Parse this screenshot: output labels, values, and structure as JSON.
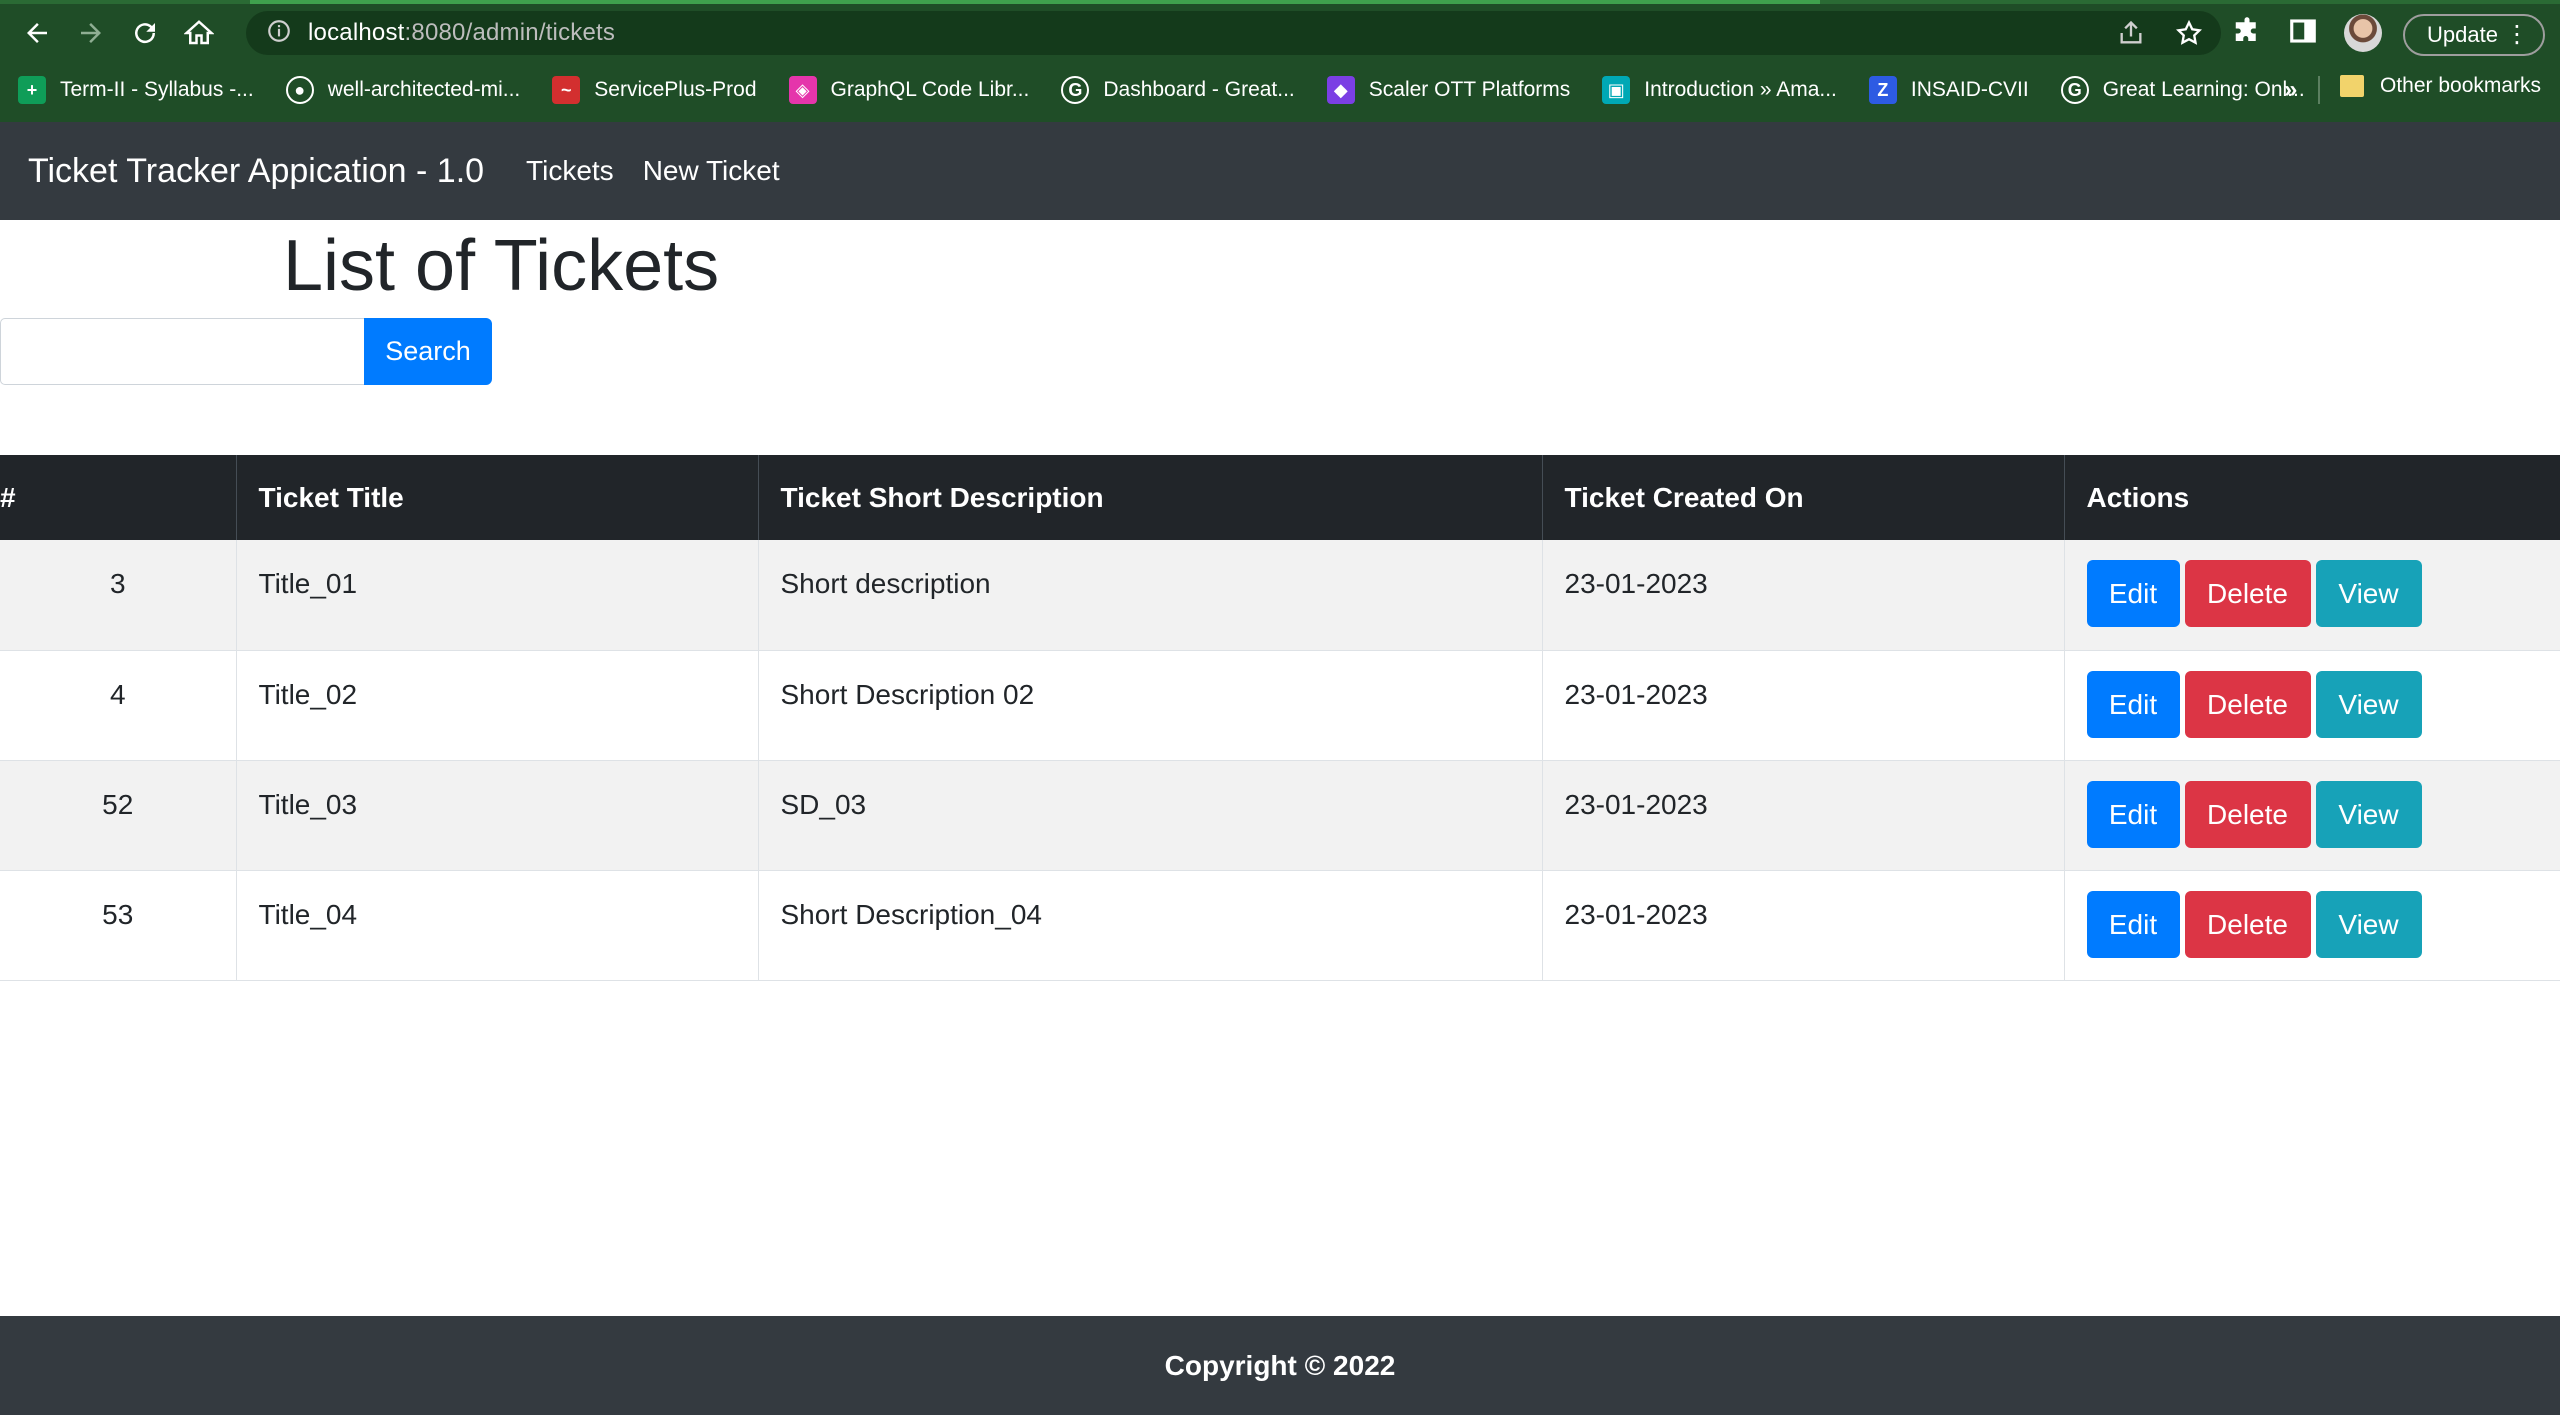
{
  "browser": {
    "url_host": "localhost",
    "url_rest": ":8080/admin/tickets",
    "update_label": "Update",
    "bookmarks": [
      {
        "label": "Term-II - Syllabus -...",
        "icon": "plus-icon",
        "color": "#0f9d58"
      },
      {
        "label": "well-architected-mi...",
        "icon": "github-icon",
        "color": "#ffffff"
      },
      {
        "label": "ServicePlus-Prod",
        "icon": "swoosh-icon",
        "color": "#d32f2f"
      },
      {
        "label": "GraphQL Code Libr...",
        "icon": "graphql-icon",
        "color": "#e535ab"
      },
      {
        "label": "Dashboard - Great...",
        "icon": "g-icon",
        "color": "#ffffff"
      },
      {
        "label": "Scaler OTT Platforms",
        "icon": "scaler-icon",
        "color": "#7b3fe4"
      },
      {
        "label": "Introduction » Ama...",
        "icon": "amazon-icon",
        "color": "#00a8b5"
      },
      {
        "label": "INSAID-CVII",
        "icon": "z-icon",
        "color": "#2d5be3"
      },
      {
        "label": "Great Learning: Onl...",
        "icon": "g-icon",
        "color": "#ffffff"
      }
    ],
    "more_label": "»",
    "other_bookmarks": "Other bookmarks"
  },
  "navbar": {
    "brand": "Ticket Tracker Appication - 1.0",
    "links": [
      "Tickets",
      "New Ticket"
    ]
  },
  "page": {
    "title": "List of Tickets",
    "search_button": "Search",
    "search_value": ""
  },
  "table": {
    "headers": [
      "#",
      "Ticket Title",
      "Ticket Short Description",
      "Ticket Created On",
      "Actions"
    ],
    "rows": [
      {
        "id": "3",
        "title": "Title_01",
        "description": "Short description",
        "created_on": "23-01-2023"
      },
      {
        "id": "4",
        "title": "Title_02",
        "description": "Short Description 02",
        "created_on": "23-01-2023"
      },
      {
        "id": "52",
        "title": "Title_03",
        "description": "SD_03",
        "created_on": "23-01-2023"
      },
      {
        "id": "53",
        "title": "Title_04",
        "description": "Short Description_04",
        "created_on": "23-01-2023"
      }
    ],
    "actions": {
      "edit": "Edit",
      "delete": "Delete",
      "view": "View"
    }
  },
  "footer": {
    "text": "Copyright © 2022"
  },
  "colors": {
    "primary": "#007bff",
    "danger": "#dc3545",
    "info": "#17a2b8",
    "navbar": "#343a40",
    "table_header": "#212529",
    "browser_theme": "#1f4d27"
  }
}
